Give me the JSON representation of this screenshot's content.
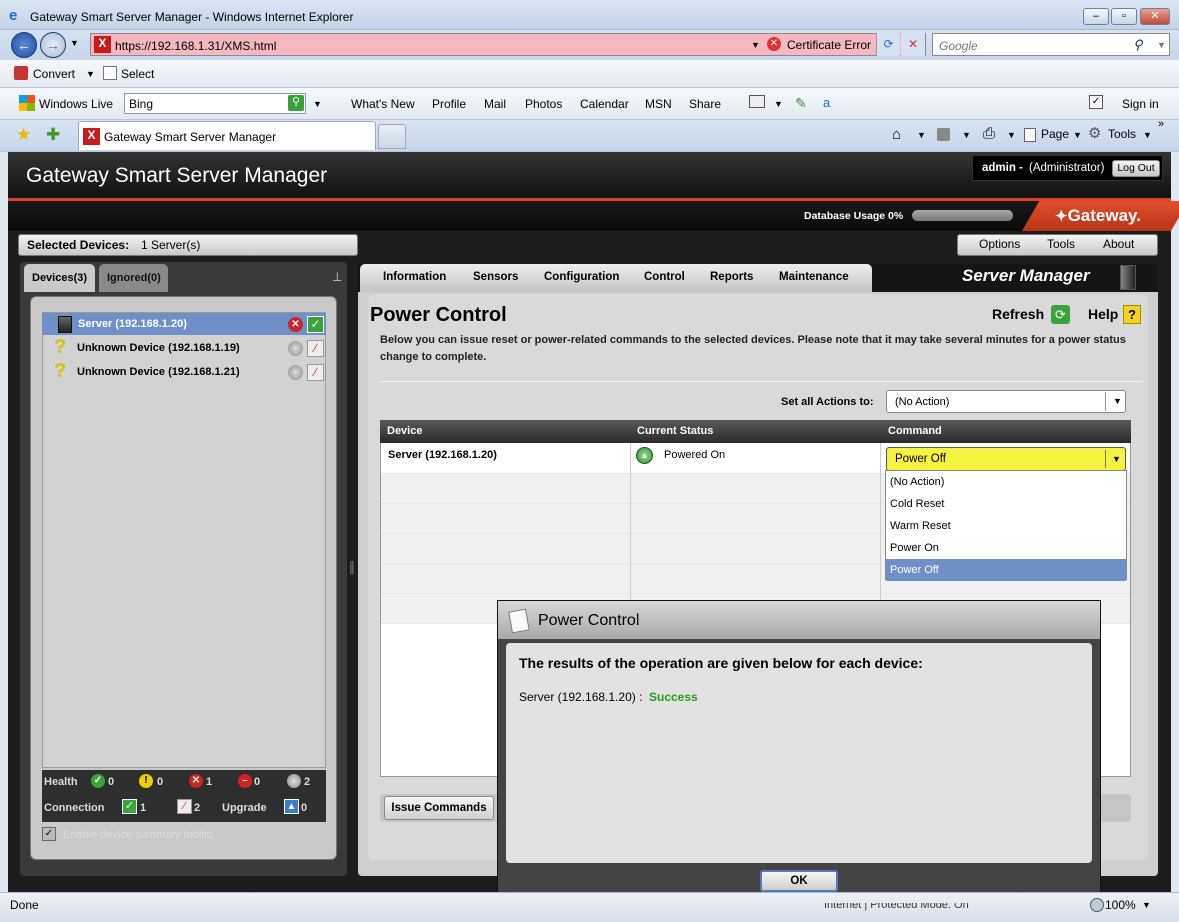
{
  "browser": {
    "title": "Gateway Smart Server Manager - Windows Internet Explorer",
    "url": "https://192.168.1.31/XMS.html",
    "cert_error": "Certificate Error",
    "search_placeholder": "Google",
    "toolbar1": {
      "convert": "Convert",
      "select": "Select"
    },
    "toolbar2": {
      "windows_live": "Windows Live",
      "bing_value": "Bing",
      "links": [
        "What's New",
        "Profile",
        "Mail",
        "Photos",
        "Calendar",
        "MSN",
        "Share"
      ],
      "sign_in": "Sign in"
    },
    "tab_title": "Gateway Smart Server Manager",
    "cmd": {
      "page": "Page",
      "tools": "Tools"
    },
    "status": "Done",
    "zone": "Internet | Protected Mode: On",
    "zoom": "100%"
  },
  "app": {
    "title": "Gateway Smart Server Manager",
    "user": "admin -",
    "role": "(Administrator)",
    "logout": "Log Out",
    "db_usage_label": "Database Usage 0%",
    "db_usage_fraction": 0,
    "brand": "Gateway.",
    "selected_devices_label": "Selected Devices:",
    "selected_devices_value": "1 Server(s)",
    "menu": {
      "options": "Options",
      "tools": "Tools",
      "about": "About"
    },
    "colors": {
      "accent": "#d8452a",
      "selection": "#6f8fc7",
      "command_highlight": "#f4f33d",
      "success": "#2c9a1f"
    }
  },
  "left": {
    "tabs": {
      "devices": "Devices(3)",
      "ignored": "Ignored(0)"
    },
    "devices": [
      {
        "name": "Server (192.168.1.20)",
        "icon": "server-icon",
        "selected": true
      },
      {
        "name": "Unknown Device (192.168.1.19)",
        "icon": "question-icon",
        "selected": false
      },
      {
        "name": "Unknown Device (192.168.1.21)",
        "icon": "question-icon",
        "selected": false
      }
    ],
    "legend": {
      "health_label": "Health",
      "health_ok": "0",
      "health_warn": "0",
      "health_error": "1",
      "health_critical": "0",
      "health_unknown": "2",
      "connection_label": "Connection",
      "conn_ok": "1",
      "conn_bad": "2",
      "upgrade_label": "Upgrade",
      "upgrade_count": "0"
    },
    "tooltip_checkbox": "Enable device summary tooltip"
  },
  "right": {
    "nav": [
      "Information",
      "Sensors",
      "Configuration",
      "Control",
      "Reports",
      "Maintenance"
    ],
    "module_title": "Server Manager",
    "page_title": "Power Control",
    "refresh": "Refresh",
    "help": "Help",
    "description": "Below you can issue reset or power-related commands to the selected devices.  Please note that it may take several minutes for a power status change to complete.",
    "set_all_label": "Set all Actions to:",
    "set_all_value": "(No Action)",
    "columns": {
      "device": "Device",
      "status": "Current Status",
      "command": "Command"
    },
    "row": {
      "device": "Server (192.168.1.20)",
      "status": "Powered On",
      "command": "Power Off"
    },
    "options": [
      "(No Action)",
      "Cold Reset",
      "Warm Reset",
      "Power On",
      "Power Off"
    ],
    "issue_button": "Issue Commands"
  },
  "dialog": {
    "title": "Power Control",
    "heading": "The results of the operation are given below for each device:",
    "device": "Server (192.168.1.20) :",
    "result": "Success",
    "ok": "OK"
  }
}
